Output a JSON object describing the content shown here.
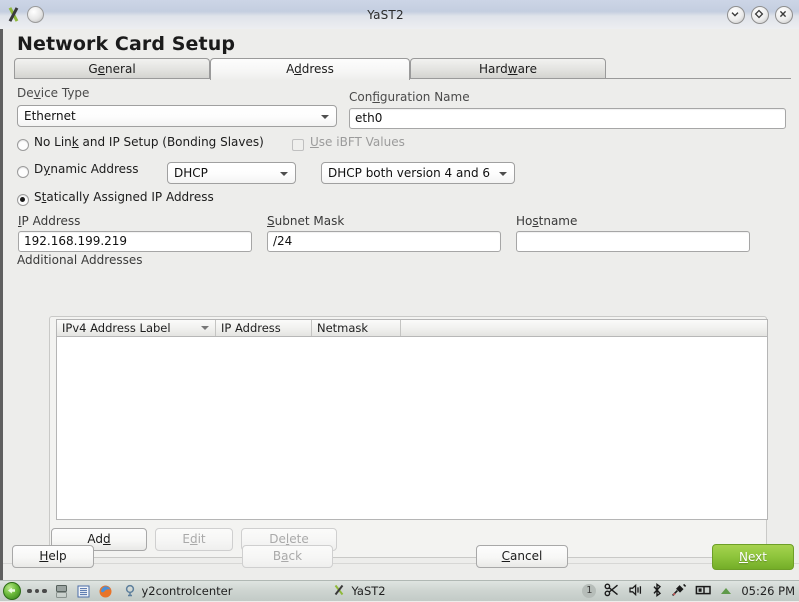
{
  "window": {
    "title": "YaST2",
    "app_icon": "yast-x-icon",
    "menu_button": "window-menu-icon",
    "controls": [
      {
        "name": "minimize-button",
        "glyph": "chevron-down-icon"
      },
      {
        "name": "maximize-button",
        "glyph": "diamond-icon"
      },
      {
        "name": "close-button",
        "glyph": "close-x-icon"
      }
    ]
  },
  "page": {
    "title": "Network Card Setup"
  },
  "tabs": [
    {
      "label": "General",
      "mnemonic": "G",
      "selected": false,
      "name": "tab-general"
    },
    {
      "label": "Address",
      "mnemonic": "A",
      "selected": true,
      "name": "tab-address"
    },
    {
      "label": "Hardware",
      "mnemonic": "w",
      "selected": false,
      "name": "tab-hardware"
    }
  ],
  "form": {
    "device_type": {
      "label_pre": "De",
      "label_mn": "v",
      "label_post": "ice Type",
      "value": "Ethernet"
    },
    "configuration_name": {
      "label_pre": "Con",
      "label_mn": "f",
      "label_post": "iguration Name",
      "value": "eth0"
    },
    "radios": [
      {
        "name": "radio-no-link",
        "selected": false,
        "label_pre": "No Lin",
        "label_mn": "k",
        "label_post": " and IP Setup (Bonding Slaves)"
      },
      {
        "name": "radio-dynamic-address",
        "selected": false,
        "label_pre": "D",
        "label_mn": "y",
        "label_post": "namic Address"
      },
      {
        "name": "radio-static-address",
        "selected": true,
        "label_pre": "S",
        "label_mn": "t",
        "label_post": "atically Assigned IP Address"
      }
    ],
    "ibft_checkbox": {
      "checked": false,
      "disabled": true,
      "label_pre": "",
      "label_mn": "U",
      "label_post": "se iBFT Values"
    },
    "dhcp_mode": {
      "value": "DHCP"
    },
    "dhcp_version": {
      "value": "DHCP both version 4 and 6"
    },
    "ip_address": {
      "label_pre": "",
      "label_mn": "I",
      "label_post": "P Address",
      "value": "192.168.199.219"
    },
    "subnet_mask": {
      "label_pre": "",
      "label_mn": "S",
      "label_post": "ubnet Mask",
      "value": "/24"
    },
    "hostname": {
      "label_pre": "Ho",
      "label_mn": "s",
      "label_post": "tname",
      "value": ""
    },
    "additional_addresses": {
      "label": "Additional Addresses",
      "columns": [
        "IPv4 Address Label",
        "IP Address",
        "Netmask"
      ],
      "sorted_column": "IPv4 Address Label",
      "rows": []
    },
    "table_buttons": [
      {
        "name": "add-button",
        "label_pre": "Ad",
        "label_mn": "d",
        "label_post": "",
        "disabled": false
      },
      {
        "name": "edit-button",
        "label_pre": "E",
        "label_mn": "d",
        "label_post": "it",
        "disabled": true
      },
      {
        "name": "delete-button",
        "label_pre": "De",
        "label_mn": "l",
        "label_post": "ete",
        "disabled": true
      }
    ]
  },
  "footer": [
    {
      "name": "help-button",
      "label_pre": "",
      "label_mn": "H",
      "label_post": "elp",
      "disabled": false,
      "primary": false
    },
    {
      "name": "back-button",
      "label_pre": "B",
      "label_mn": "a",
      "label_post": "ck",
      "disabled": true,
      "primary": false
    },
    {
      "name": "cancel-button",
      "label_pre": "",
      "label_mn": "C",
      "label_post": "ancel",
      "disabled": false,
      "primary": false
    },
    {
      "name": "next-button",
      "label_pre": "",
      "label_mn": "N",
      "label_post": "ext",
      "disabled": false,
      "primary": true
    }
  ],
  "taskbar": {
    "start_label": "start-menu-orb",
    "quick_launch": [
      "show-desktop-icon",
      "file-manager-icon",
      "firefox-icon"
    ],
    "tasks": [
      {
        "name": "taskbar-item-y2controlcenter",
        "label": "y2controlcenter",
        "icon": "yast-control-center-icon"
      },
      {
        "name": "taskbar-item-yast2",
        "label": "YaST2",
        "icon": "yast-x-icon"
      }
    ],
    "tray": {
      "desktop_number": "1",
      "icons": [
        "network-disconnected-icon",
        "volume-icon",
        "bluetooth-icon",
        "power-plug-icon",
        "battery-icon",
        "updates-icon"
      ],
      "clock": "05:26 PM"
    }
  },
  "colors": {
    "accent_green": "#8fc63d",
    "dialog_bg": "#ededeb",
    "titlebar_blue": "#c4cee0"
  }
}
